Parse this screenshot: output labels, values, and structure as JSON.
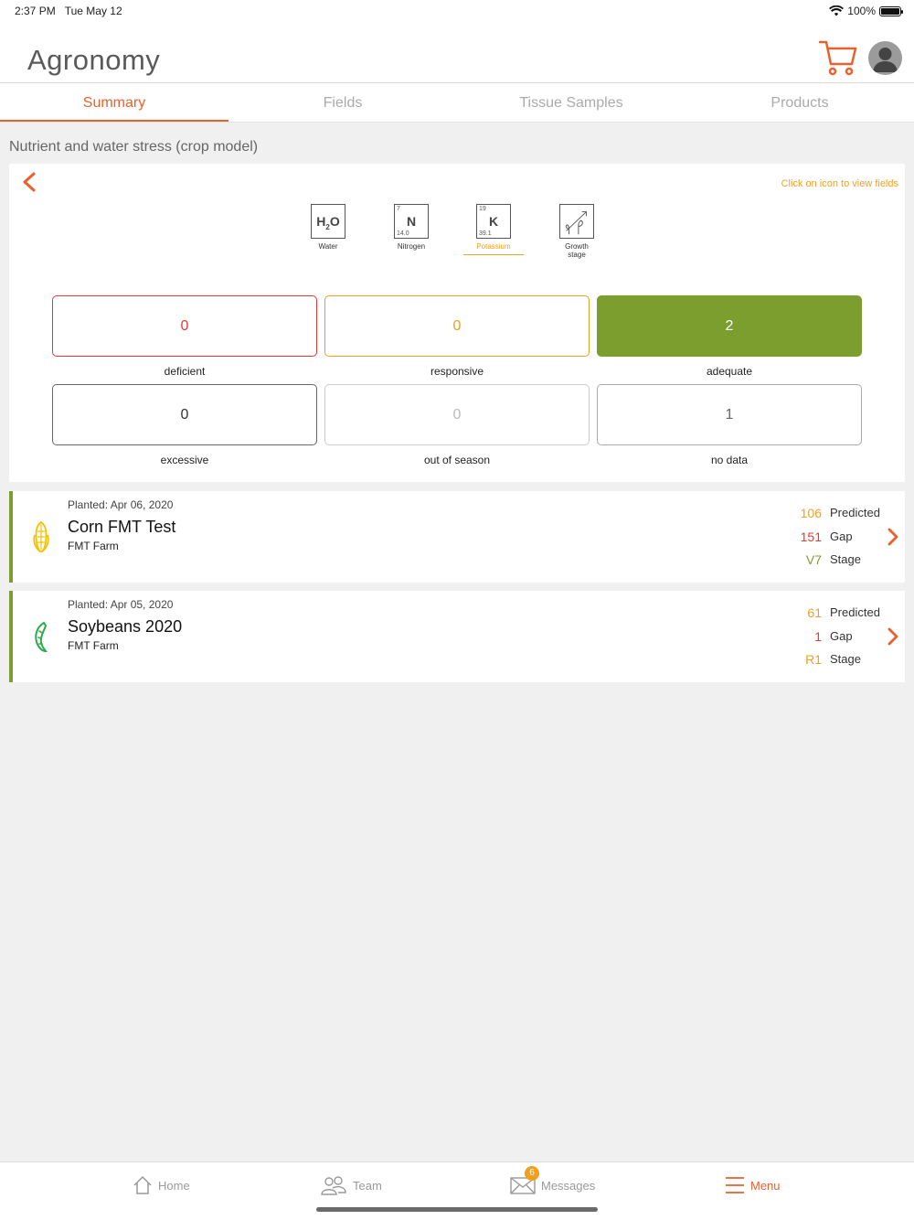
{
  "status_bar": {
    "time": "2:37 PM",
    "date": "Tue May 12",
    "battery": "100%"
  },
  "header": {
    "title": "Agronomy"
  },
  "tabs": [
    {
      "label": "Summary",
      "active": true
    },
    {
      "label": "Fields",
      "active": false
    },
    {
      "label": "Tissue Samples",
      "active": false
    },
    {
      "label": "Products",
      "active": false
    }
  ],
  "section_title": "Nutrient and water stress (crop model)",
  "hint": "Click on icon to view fields",
  "nutrients": [
    {
      "symbol": "H2O",
      "label": "Water",
      "number": "",
      "mass": ""
    },
    {
      "symbol": "N",
      "label": "Nitrogen",
      "number": "7",
      "mass": "14.0"
    },
    {
      "symbol": "K",
      "label": "Potassium",
      "number": "19",
      "mass": "39.1",
      "active": true
    },
    {
      "symbol": "",
      "label": "Growth stage",
      "number": "",
      "mass": ""
    }
  ],
  "stats": [
    {
      "value": "0",
      "label": "deficient",
      "color": "#e53935"
    },
    {
      "value": "0",
      "label": "responsive",
      "color": "#f0a020"
    },
    {
      "value": "2",
      "label": "adequate",
      "color": "#ffffff",
      "fill": "#7b9e2f"
    },
    {
      "value": "0",
      "label": "excessive",
      "color": "#333333"
    },
    {
      "value": "0",
      "label": "out of season",
      "color": "#bbbbbb"
    },
    {
      "value": "1",
      "label": "no data",
      "color": "#666666"
    }
  ],
  "fields": [
    {
      "planted": "Planted: Apr 06, 2020",
      "name": "Corn FMT Test",
      "farm": "FMT Farm",
      "icon": "corn-icon",
      "predicted": "106",
      "predicted_label": "Predicted",
      "gap": "151",
      "gap_label": "Gap",
      "stage": "V7",
      "stage_label": "Stage",
      "stage_color": "#7b9e2f"
    },
    {
      "planted": "Planted: Apr 05, 2020",
      "name": "Soybeans 2020",
      "farm": "FMT Farm",
      "icon": "soybean-icon",
      "predicted": "61",
      "predicted_label": "Predicted",
      "gap": "1",
      "gap_label": "Gap",
      "stage": "R1",
      "stage_label": "Stage",
      "stage_color": "#f0a020"
    }
  ],
  "colors": {
    "accent": "#e8612c",
    "predicted": "#f0a020",
    "gap": "#e53935",
    "green": "#7b9e2f"
  },
  "bottom_nav": [
    {
      "label": "Home",
      "icon": "home-icon"
    },
    {
      "label": "Team",
      "icon": "team-icon"
    },
    {
      "label": "Messages",
      "icon": "mail-icon",
      "badge": "6"
    },
    {
      "label": "Menu",
      "icon": "menu-icon",
      "active": true
    }
  ]
}
